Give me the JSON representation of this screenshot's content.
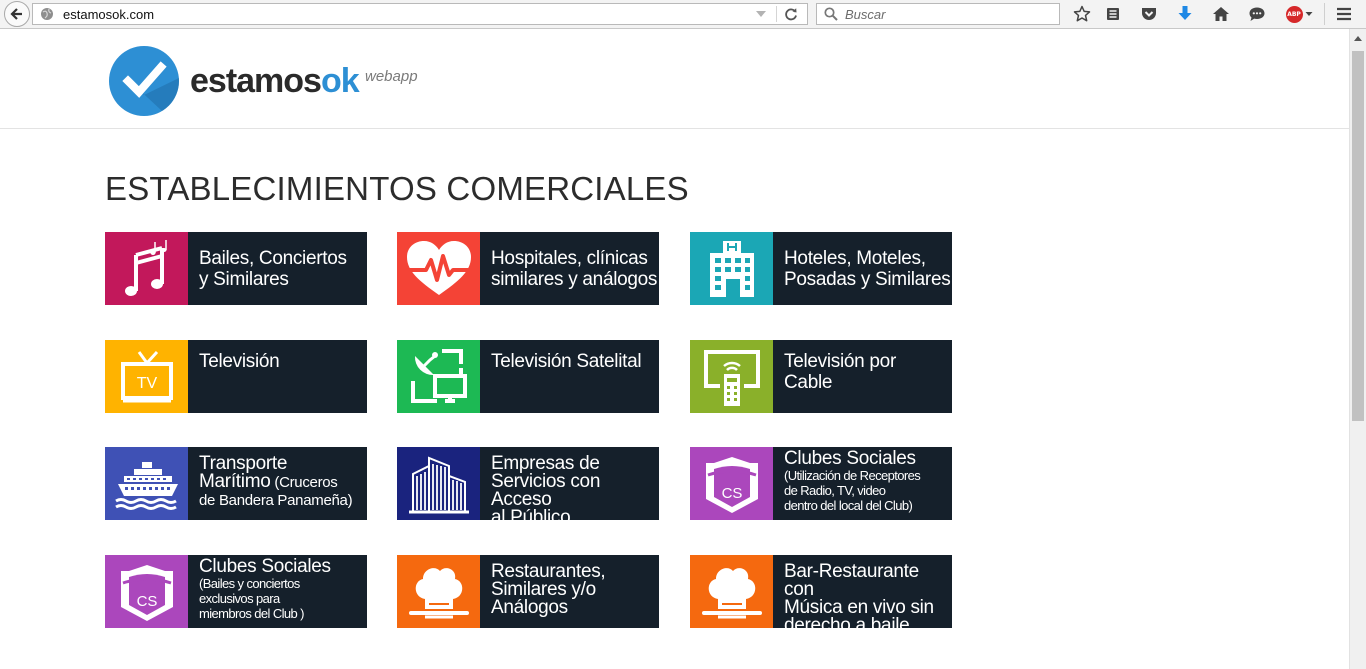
{
  "browser": {
    "url": "estamosok.com",
    "search_placeholder": "Buscar",
    "abp_label": "ABP"
  },
  "header": {
    "logo_main": "estamos",
    "logo_accent": "ok",
    "logo_sub": "webapp"
  },
  "page": {
    "title": "ESTABLECIMIENTOS COMERCIALES"
  },
  "tiles": [
    {
      "icon": "music-icon",
      "color": "#c2185b",
      "line1": "Bailes, Conciertos",
      "line2": "y Similares"
    },
    {
      "icon": "heart-pulse-icon",
      "color": "#f44336",
      "line1": "Hospitales, clínicas",
      "line2": "similares y análogos"
    },
    {
      "icon": "hotel-icon",
      "color": "#1ba7b5",
      "line1": "Hoteles, Moteles,",
      "line2": "Posadas y Similares"
    },
    {
      "icon": "tv-icon",
      "color": "#ffb300",
      "icon_text": "TV",
      "line1": "Televisión"
    },
    {
      "icon": "satellite-tv-icon",
      "color": "#1db954",
      "line1": "Televisión Satelital"
    },
    {
      "icon": "cable-tv-icon",
      "color": "#8ab02a",
      "line1": "Televisión por",
      "line2": "Cable"
    },
    {
      "icon": "ship-icon",
      "color": "#3f51b5",
      "line1": "Transporte",
      "line2": "Marítimo",
      "line2_small": " (Cruceros",
      "line3": "de Bandera Panameña)"
    },
    {
      "icon": "buildings-icon",
      "color": "#1a237e",
      "line1": "Empresas de",
      "line2": "Servicios con Acceso",
      "line3": "al Público"
    },
    {
      "icon": "club-badge-icon",
      "color": "#ab47bc",
      "icon_text": "CS",
      "line1": "Clubes Sociales",
      "sub1": "(Utilización de Receptores",
      "sub2": "de Radio, TV, video",
      "sub3": "dentro del local del Club)"
    },
    {
      "icon": "club-badge-icon",
      "color": "#ab47bc",
      "icon_text": "CS",
      "line1": "Clubes Sociales",
      "sub1": "(Bailes y conciertos",
      "sub2": "exclusivos para",
      "sub3": "miembros del Club )"
    },
    {
      "icon": "chef-hat-icon",
      "color": "#f5690f",
      "line1": "Restaurantes,",
      "line2": "Similares y/o",
      "line3": "Análogos"
    },
    {
      "icon": "chef-hat-icon",
      "color": "#f5690f",
      "line1": "Bar-Restaurante con",
      "line2": "Música en vivo sin",
      "line3": "derecho a baile"
    }
  ]
}
